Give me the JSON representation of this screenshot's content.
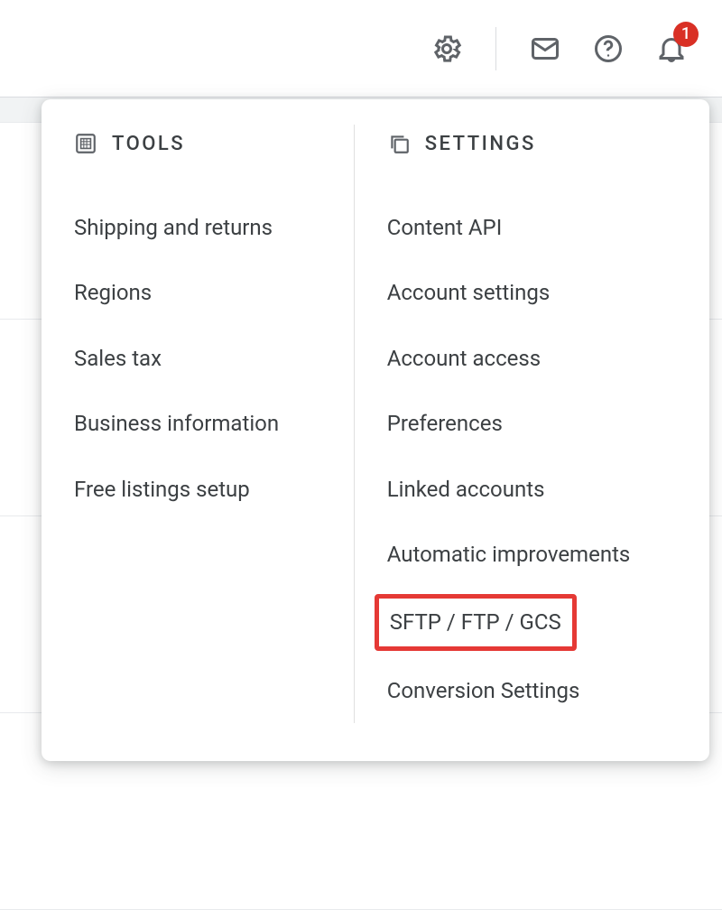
{
  "toolbar": {
    "notification_count": "1"
  },
  "dropdown": {
    "tools": {
      "header": "TOOLS",
      "items": [
        "Shipping and returns",
        "Regions",
        "Sales tax",
        "Business information",
        "Free listings setup"
      ]
    },
    "settings": {
      "header": "SETTINGS",
      "items": [
        "Content API",
        "Account settings",
        "Account access",
        "Preferences",
        "Linked accounts",
        "Automatic improvements",
        "SFTP / FTP / GCS",
        "Conversion Settings"
      ],
      "highlighted_index": 6
    }
  }
}
